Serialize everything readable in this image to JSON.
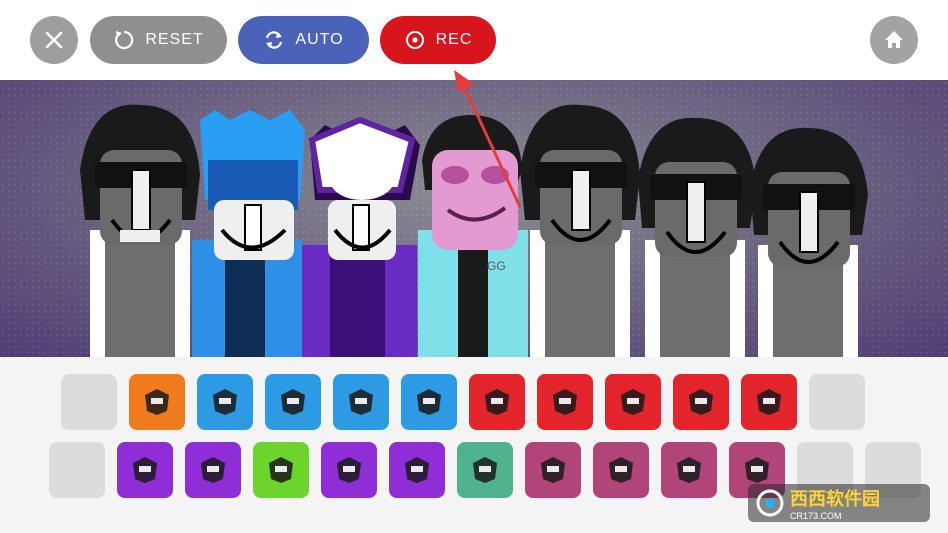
{
  "toolbar": {
    "close_icon": "close-icon",
    "reset_label": "RESET",
    "auto_label": "AUTO",
    "rec_label": "REC",
    "home_icon": "home-icon"
  },
  "colors": {
    "close_bg": "#9e9e9e",
    "reset_bg": "#8f8f8f",
    "auto_bg": "#4a63b8",
    "rec_bg": "#d6161c",
    "home_bg": "#a3a3a3",
    "annotation_arrow": "#e63b3b"
  },
  "characters": [
    {
      "name": "character-1",
      "style": "default-gray"
    },
    {
      "name": "character-2",
      "style": "blue"
    },
    {
      "name": "character-3",
      "style": "purple"
    },
    {
      "name": "character-4",
      "style": "pink-cyan"
    },
    {
      "name": "character-5",
      "style": "default-gray"
    },
    {
      "name": "character-6",
      "style": "default-gray"
    },
    {
      "name": "character-7",
      "style": "default-gray"
    }
  ],
  "sound_icons_row1": [
    {
      "name": "empty-slot",
      "color": "#dcdcdc"
    },
    {
      "name": "beat-icon-orange",
      "color": "#f07c1e"
    },
    {
      "name": "beat-icon-blue-1",
      "color": "#2c9be4"
    },
    {
      "name": "beat-icon-blue-2",
      "color": "#2c9be4"
    },
    {
      "name": "beat-icon-blue-3",
      "color": "#2c9be4"
    },
    {
      "name": "beat-icon-blue-4",
      "color": "#2c9be4"
    },
    {
      "name": "effect-icon-red-1",
      "color": "#e3242b"
    },
    {
      "name": "effect-icon-red-2",
      "color": "#e3242b"
    },
    {
      "name": "effect-icon-red-3",
      "color": "#e3242b"
    },
    {
      "name": "effect-icon-red-4",
      "color": "#e3242b"
    },
    {
      "name": "effect-icon-red-5",
      "color": "#e3242b"
    },
    {
      "name": "empty-slot",
      "color": "#dcdcdc"
    }
  ],
  "sound_icons_row2": [
    {
      "name": "empty-slot",
      "color": "#dcdcdc"
    },
    {
      "name": "melody-icon-purple-1",
      "color": "#8f2ed6"
    },
    {
      "name": "melody-icon-purple-2",
      "color": "#8f2ed6"
    },
    {
      "name": "melody-icon-green",
      "color": "#6cd42a"
    },
    {
      "name": "melody-icon-purple-3",
      "color": "#8f2ed6"
    },
    {
      "name": "melody-icon-purple-4",
      "color": "#8f2ed6"
    },
    {
      "name": "voice-icon-teal",
      "color": "#4fb38d"
    },
    {
      "name": "voice-icon-mauve-1",
      "color": "#b1457a"
    },
    {
      "name": "voice-icon-mauve-2",
      "color": "#b1457a"
    },
    {
      "name": "voice-icon-mauve-3",
      "color": "#b1457a"
    },
    {
      "name": "voice-icon-mauve-4",
      "color": "#b1457a"
    },
    {
      "name": "empty-slot",
      "color": "#dcdcdc"
    },
    {
      "name": "empty-slot",
      "color": "#dcdcdc"
    }
  ],
  "watermark": {
    "main": "西西软件园",
    "sub": "CR173.COM"
  }
}
